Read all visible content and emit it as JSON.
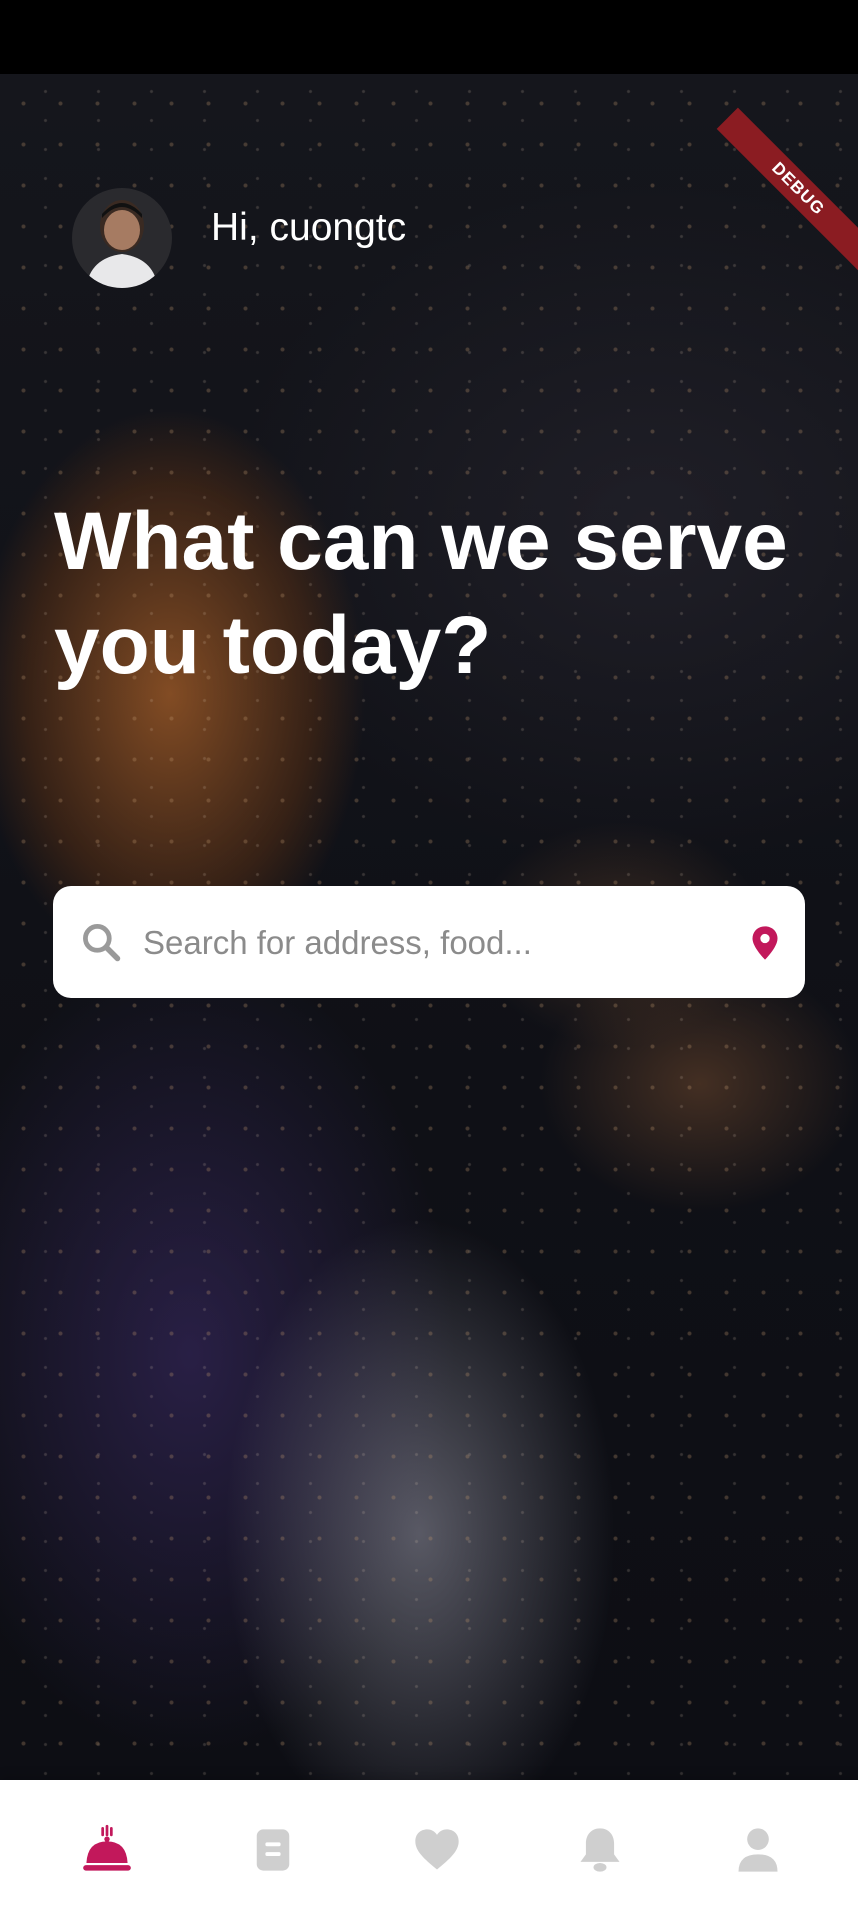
{
  "debug_banner": "DEBUG",
  "header": {
    "greeting": "Hi, cuongtc",
    "avatar_icon": "user-avatar"
  },
  "hero": {
    "headline": "What can we serve you today?"
  },
  "search": {
    "placeholder": "Search for address, food...",
    "value": ""
  },
  "bottom_nav": {
    "items": [
      {
        "icon": "cloche-icon",
        "active": true
      },
      {
        "icon": "orders-icon",
        "active": false
      },
      {
        "icon": "heart-icon",
        "active": false
      },
      {
        "icon": "bell-icon",
        "active": false
      },
      {
        "icon": "profile-icon",
        "active": false
      }
    ]
  },
  "colors": {
    "accent": "#c2185b",
    "inactive": "#cfcfcf",
    "debug_ribbon": "#8b1c22"
  }
}
